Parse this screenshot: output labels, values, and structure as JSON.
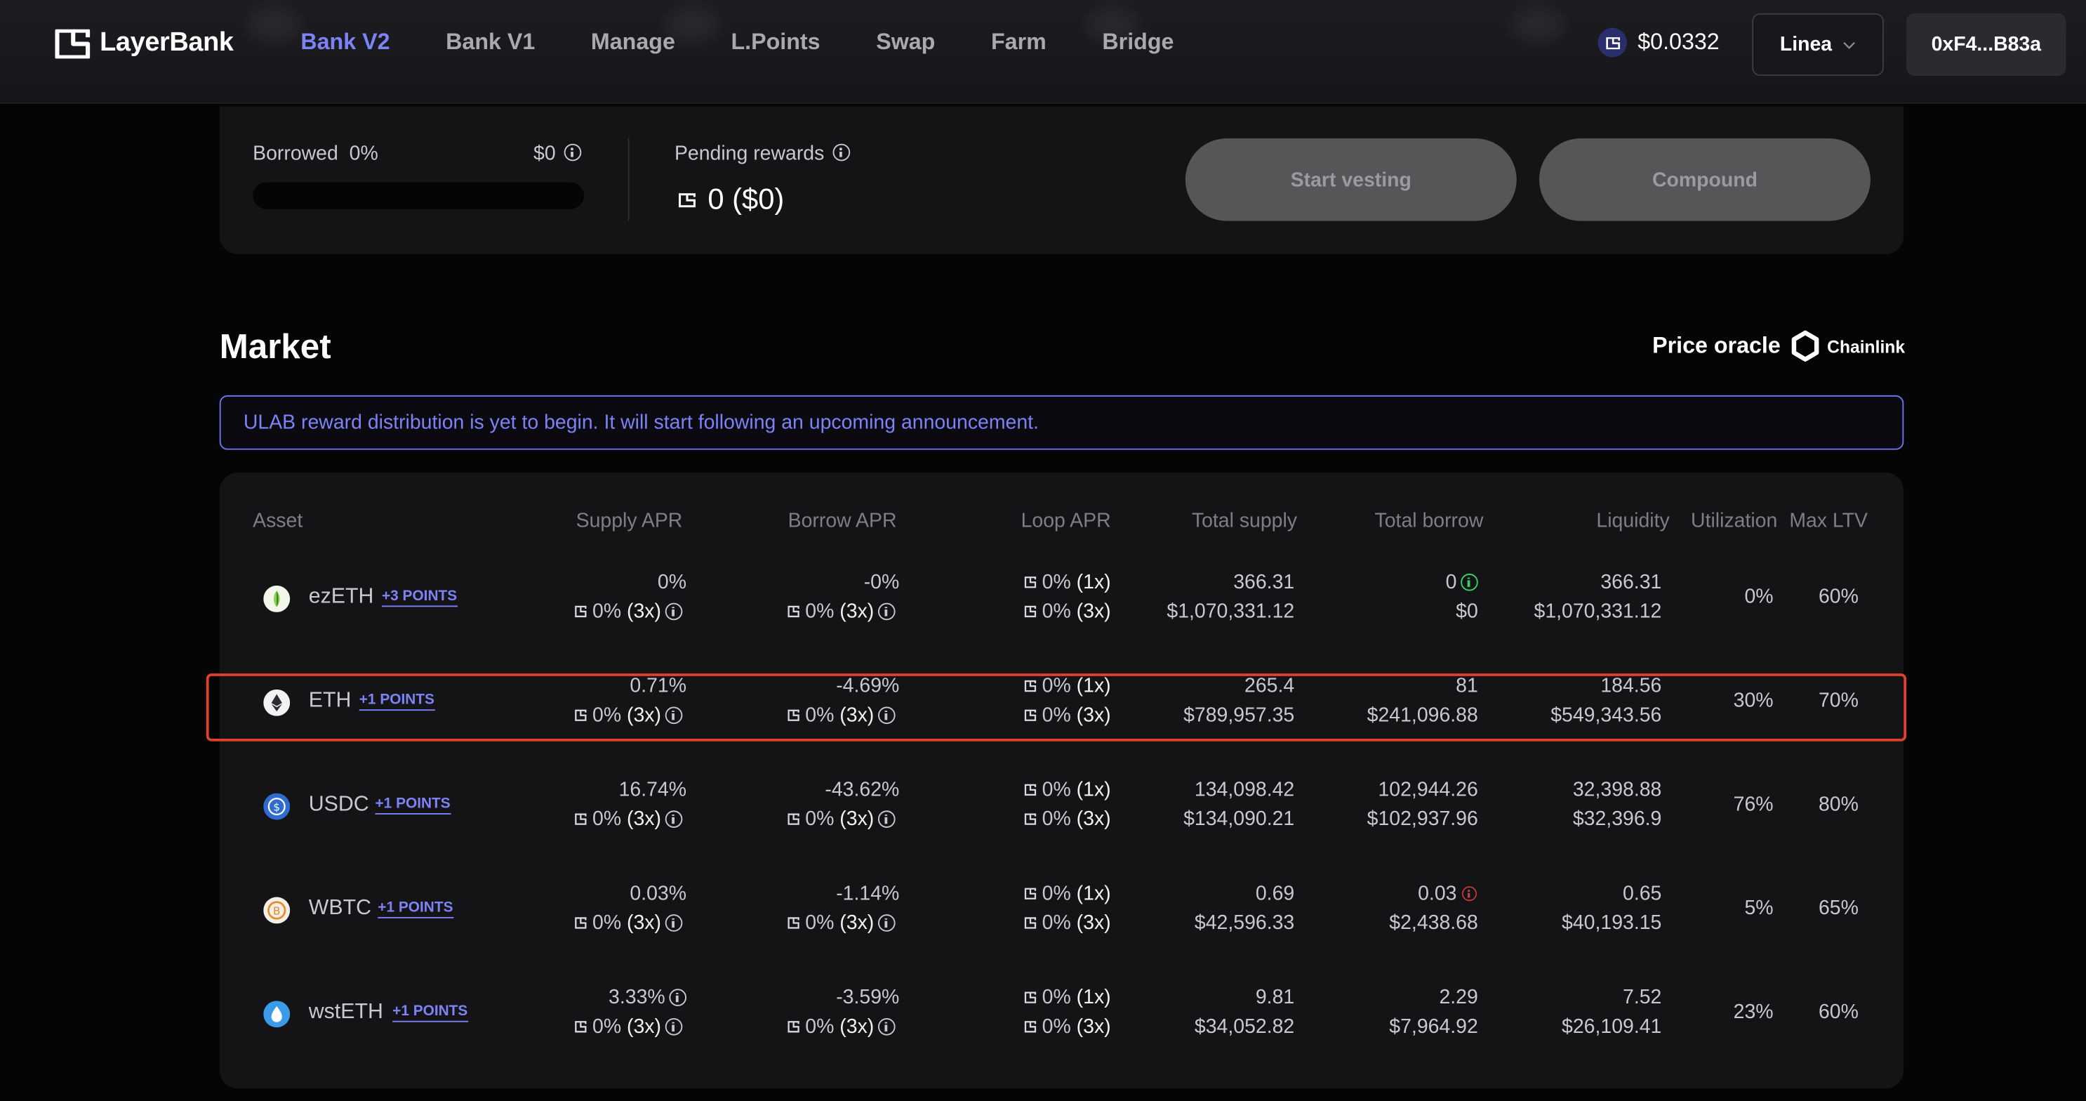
{
  "header": {
    "brand": "LayerBank",
    "nav": [
      "Bank V2",
      "Bank V1",
      "Manage",
      "L.Points",
      "Swap",
      "Farm",
      "Bridge"
    ],
    "active_nav": "Bank V2",
    "token_price": "$0.0332",
    "network": "Linea",
    "wallet": "0xF4...B83a"
  },
  "rewards": {
    "borrowed_label": "Borrowed",
    "borrowed_pct": "0%",
    "borrowed_value": "$0",
    "borrowed_progress": 0,
    "pending_label": "Pending rewards",
    "pending_value": "0 ($0)",
    "start_vesting": "Start vesting",
    "compound": "Compound"
  },
  "market": {
    "title": "Market",
    "oracle_label": "Price oracle",
    "oracle_brand": "Chainlink",
    "notice": "ULAB reward distribution is yet to begin. It will start following an upcoming announcement.",
    "headers": [
      "Asset",
      "Supply APR",
      "Borrow APR",
      "Loop APR",
      "Total supply",
      "Total borrow",
      "Liquidity",
      "Utilization",
      "Max LTV"
    ],
    "rows": [
      {
        "asset": "ezETH",
        "points": "+3 POINTS",
        "supply_apr": "0%",
        "supply_reward": "0%",
        "supply_mult": "(3x)",
        "borrow_apr": "-0%",
        "borrow_reward": "0%",
        "borrow_mult": "(3x)",
        "loop_1": "0%",
        "loop_1_mult": "(1x)",
        "loop_3": "0%",
        "loop_3_mult": "(3x)",
        "total_supply": "366.31",
        "total_supply_usd": "$1,070,331.12",
        "total_borrow": "0",
        "total_borrow_usd": "$0",
        "liquidity": "366.31",
        "liquidity_usd": "$1,070,331.12",
        "utilization": "0%",
        "max_ltv": "60%"
      },
      {
        "asset": "ETH",
        "points": "+1 POINTS",
        "supply_apr": "0.71%",
        "supply_reward": "0%",
        "supply_mult": "(3x)",
        "borrow_apr": "-4.69%",
        "borrow_reward": "0%",
        "borrow_mult": "(3x)",
        "loop_1": "0%",
        "loop_1_mult": "(1x)",
        "loop_3": "0%",
        "loop_3_mult": "(3x)",
        "total_supply": "265.4",
        "total_supply_usd": "$789,957.35",
        "total_borrow": "81",
        "total_borrow_usd": "$241,096.88",
        "liquidity": "184.56",
        "liquidity_usd": "$549,343.56",
        "utilization": "30%",
        "max_ltv": "70%"
      },
      {
        "asset": "USDC",
        "points": "+1 POINTS",
        "supply_apr": "16.74%",
        "supply_reward": "0%",
        "supply_mult": "(3x)",
        "borrow_apr": "-43.62%",
        "borrow_reward": "0%",
        "borrow_mult": "(3x)",
        "loop_1": "0%",
        "loop_1_mult": "(1x)",
        "loop_3": "0%",
        "loop_3_mult": "(3x)",
        "total_supply": "134,098.42",
        "total_supply_usd": "$134,090.21",
        "total_borrow": "102,944.26",
        "total_borrow_usd": "$102,937.96",
        "liquidity": "32,398.88",
        "liquidity_usd": "$32,396.9",
        "utilization": "76%",
        "max_ltv": "80%"
      },
      {
        "asset": "WBTC",
        "points": "+1 POINTS",
        "supply_apr": "0.03%",
        "supply_reward": "0%",
        "supply_mult": "(3x)",
        "borrow_apr": "-1.14%",
        "borrow_reward": "0%",
        "borrow_mult": "(3x)",
        "loop_1": "0%",
        "loop_1_mult": "(1x)",
        "loop_3": "0%",
        "loop_3_mult": "(3x)",
        "total_supply": "0.69",
        "total_supply_usd": "$42,596.33",
        "total_borrow": "0.03",
        "total_borrow_usd": "$2,438.68",
        "liquidity": "0.65",
        "liquidity_usd": "$40,193.15",
        "utilization": "5%",
        "max_ltv": "65%"
      },
      {
        "asset": "wstETH",
        "points": "+1 POINTS",
        "supply_apr": "3.33%",
        "supply_reward": "0%",
        "supply_mult": "(3x)",
        "borrow_apr": "-3.59%",
        "borrow_reward": "0%",
        "borrow_mult": "(3x)",
        "loop_1": "0%",
        "loop_1_mult": "(1x)",
        "loop_3": "0%",
        "loop_3_mult": "(3x)",
        "total_supply": "9.81",
        "total_supply_usd": "$34,052.82",
        "total_borrow": "2.29",
        "total_borrow_usd": "$7,964.92",
        "liquidity": "7.52",
        "liquidity_usd": "$26,109.41",
        "utilization": "23%",
        "max_ltv": "60%"
      }
    ]
  },
  "colors": {
    "accent": "#7d82f5",
    "highlight": "#e0402e",
    "background": "#050506",
    "card": "#141417"
  }
}
